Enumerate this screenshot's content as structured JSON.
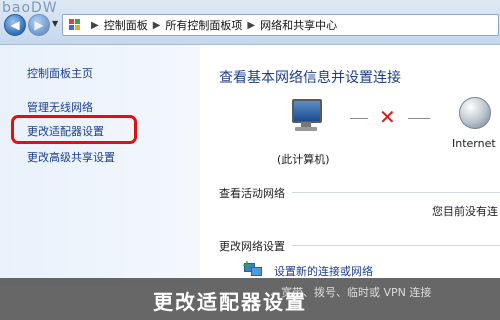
{
  "watermark": "baoDW",
  "breadcrumb": [
    "控制面板",
    "所有控制面板项",
    "网络和共享中心"
  ],
  "sidebar": {
    "items": [
      {
        "label": "控制面板主页"
      },
      {
        "label": "管理无线网络"
      },
      {
        "label": "更改适配器设置"
      },
      {
        "label": "更改高级共享设置"
      }
    ]
  },
  "main": {
    "title": "查看基本网络信息并设置连接",
    "computer_label": "(此计算机)",
    "internet_label": "Internet",
    "active_section": "查看活动网络",
    "no_connection": "您目前没有连",
    "change_section": "更改网络设置",
    "setup_link": "设置新的连接或网络",
    "setup_desc": "、宽带、拨号、临时或 VPN 连接"
  },
  "caption": "更改适配器设置",
  "colors": {
    "highlight": "#e01010",
    "link": "#1a3d8f",
    "title": "#1e3e8a"
  }
}
